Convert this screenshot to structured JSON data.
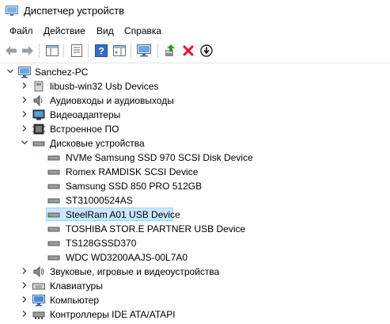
{
  "window": {
    "title": "Диспетчер устройств"
  },
  "menu": [
    "Файл",
    "Действие",
    "Вид",
    "Справка"
  ],
  "tree": {
    "root": "Sanchez-PC",
    "categories": [
      {
        "label": "libusb-win32 Usb Devices",
        "icon": "usb-icon"
      },
      {
        "label": "Аудиовходы и аудиовыходы",
        "icon": "speaker-icon"
      },
      {
        "label": "Видеоадаптеры",
        "icon": "display-adapter-icon"
      },
      {
        "label": "Встроенное ПО",
        "icon": "firmware-icon"
      },
      {
        "label": "Дисковые устройства",
        "icon": "disk-drive-icon",
        "expanded": true
      }
    ],
    "disks": [
      "NVMe Samsung SSD 970 SCSI Disk Device",
      "Romex RAMDISK SCSI Device",
      "Samsung SSD 850 PRO 512GB",
      "ST31000524AS",
      "SteelRam A01 USB Device",
      "TOSHIBA STOR.E PARTNER USB Device",
      "TS128GSSD370",
      "WDC WD3200AAJS-00L7A0"
    ],
    "selected_disk": "SteelRam A01 USB Device",
    "more_categories": [
      {
        "label": "Звуковые, игровые и видеоустройства",
        "icon": "sound-icon"
      },
      {
        "label": "Клавиатуры",
        "icon": "keyboard-icon"
      },
      {
        "label": "Компьютер",
        "icon": "computer-icon"
      },
      {
        "label": "Контроллеры IDE ATA/ATAPI",
        "icon": "ide-controller-icon"
      }
    ]
  },
  "colors": {
    "selection": "#cce8ff",
    "selection_border": "#99d1ff",
    "remove_red": "#e81123"
  }
}
